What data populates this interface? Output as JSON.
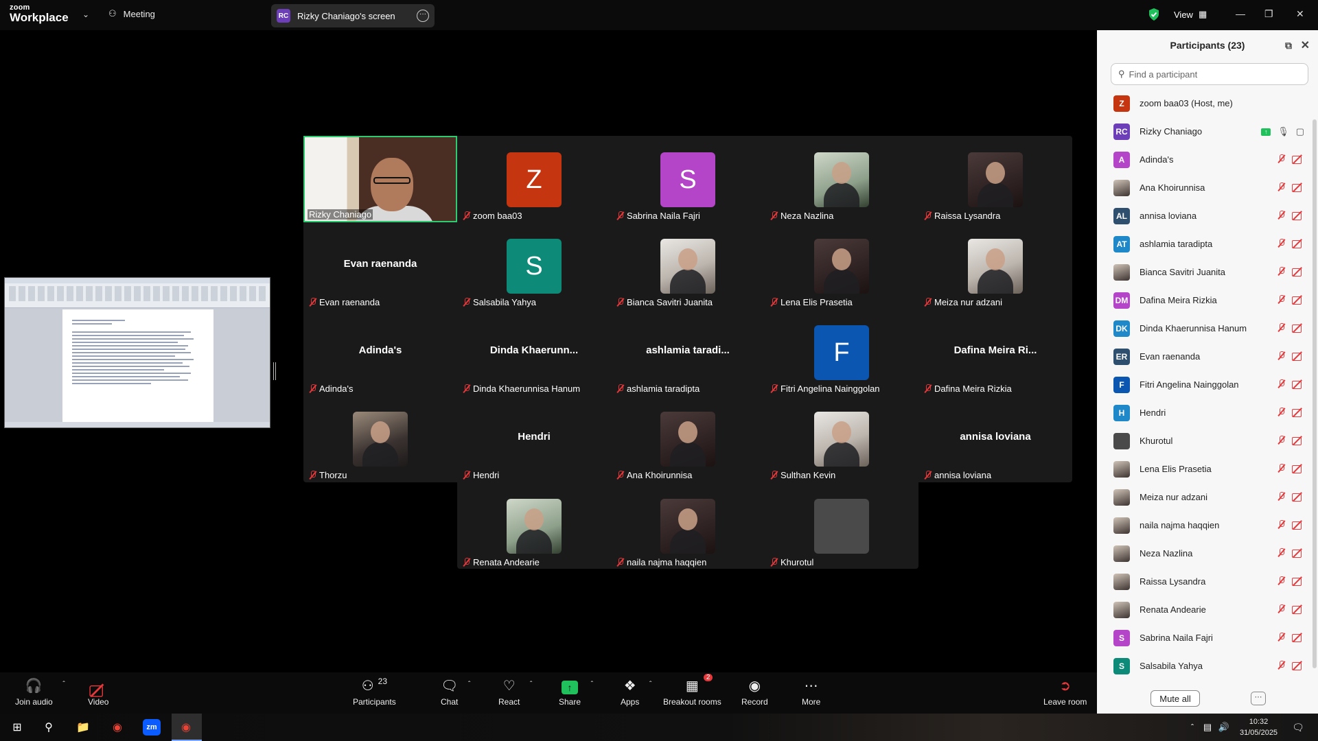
{
  "title_bar": {
    "logo_top": "zoom",
    "logo_bottom": "Workplace",
    "meeting_label": "Meeting",
    "screen_tab_badge": "RC",
    "screen_tab_label": "Rizky Chaniago's screen",
    "view_label": "View"
  },
  "gallery": {
    "tiles": [
      {
        "name": "Rizky Chaniago",
        "type": "video"
      },
      {
        "name": "zoom baa03",
        "initial": "Z",
        "color": "#c5350f"
      },
      {
        "name": "Sabrina Naila Fajri",
        "initial": "S",
        "color": "#b444c8"
      },
      {
        "name": "Neza Nazlina",
        "type": "photo"
      },
      {
        "name": "Raissa Lysandra",
        "type": "photo"
      },
      {
        "name": "Evan raenanda",
        "big": "Evan raenanda"
      },
      {
        "name": "Salsabila Yahya",
        "initial": "S",
        "color": "#0d8a78"
      },
      {
        "name": "Bianca Savitri Juanita",
        "type": "photo"
      },
      {
        "name": "Lena Elis Prasetia",
        "type": "photo"
      },
      {
        "name": "Meiza nur adzani",
        "type": "photo"
      },
      {
        "name": "Adinda's",
        "big": "Adinda's"
      },
      {
        "name": "Dinda Khaerunnisa Hanum",
        "big": "Dinda  Khaerunn..."
      },
      {
        "name": "ashlamia taradipta",
        "big": "ashlamia  taradi..."
      },
      {
        "name": "Fitri Angelina Nainggolan",
        "initial": "F",
        "color": "#0a56b0"
      },
      {
        "name": "Dafina Meira Rizkia",
        "big": "Dafina Meira Ri..."
      },
      {
        "name": "Thorzu",
        "type": "photo"
      },
      {
        "name": "Hendri",
        "big": "Hendri"
      },
      {
        "name": "Ana Khoirunnisa",
        "type": "photo"
      },
      {
        "name": "Sulthan Kevin",
        "type": "photo"
      },
      {
        "name": "annisa loviana",
        "big": "annisa loviana"
      },
      {
        "name": "Renata Andearie",
        "type": "photo"
      },
      {
        "name": "naila najma haqqien",
        "type": "photo"
      },
      {
        "name": "Khurotul",
        "initial": "",
        "color": "#4a4a4a"
      }
    ]
  },
  "participants_panel": {
    "title": "Participants (23)",
    "search_placeholder": "Find a participant",
    "mute_all_label": "Mute all",
    "more_label": "···",
    "list": [
      {
        "name": "zoom baa03 (Host, me)",
        "initial": "Z",
        "color": "#c5350f",
        "icons": false
      },
      {
        "name": "Rizky Chaniago",
        "initial": "RC",
        "color": "#6c3fb8",
        "sharing": true
      },
      {
        "name": "Adinda's",
        "initial": "A",
        "color": "#b444c8"
      },
      {
        "name": "Ana Khoirunnisa",
        "photo": true
      },
      {
        "name": "annisa loviana",
        "initial": "AL",
        "color": "#2f4f6f"
      },
      {
        "name": "ashlamia taradipta",
        "initial": "AT",
        "color": "#1e88c9"
      },
      {
        "name": "Bianca Savitri Juanita",
        "photo": true
      },
      {
        "name": "Dafina Meira Rizkia",
        "initial": "DM",
        "color": "#b444c8"
      },
      {
        "name": "Dinda Khaerunnisa Hanum",
        "initial": "DK",
        "color": "#1e88c9"
      },
      {
        "name": "Evan raenanda",
        "initial": "ER",
        "color": "#2f4f6f"
      },
      {
        "name": "Fitri Angelina Nainggolan",
        "initial": "F",
        "color": "#0a56b0"
      },
      {
        "name": "Hendri",
        "initial": "H",
        "color": "#1e88c9"
      },
      {
        "name": "Khurotul",
        "initial": "",
        "color": "#4a4a4a"
      },
      {
        "name": "Lena Elis Prasetia",
        "photo": true
      },
      {
        "name": "Meiza nur adzani",
        "photo": true
      },
      {
        "name": "naila najma haqqien",
        "photo": true
      },
      {
        "name": "Neza Nazlina",
        "photo": true
      },
      {
        "name": "Raissa Lysandra",
        "photo": true
      },
      {
        "name": "Renata Andearie",
        "photo": true
      },
      {
        "name": "Sabrina Naila Fajri",
        "initial": "S",
        "color": "#b444c8"
      },
      {
        "name": "Salsabila Yahya",
        "initial": "S",
        "color": "#0d8a78"
      }
    ]
  },
  "toolbar": {
    "join_audio": "Join audio",
    "video": "Video",
    "participants": "Participants",
    "participants_count": "23",
    "chat": "Chat",
    "react": "React",
    "share": "Share",
    "apps": "Apps",
    "breakout_rooms": "Breakout rooms",
    "breakout_badge": "2",
    "record": "Record",
    "more": "More",
    "leave_room": "Leave room"
  },
  "taskbar": {
    "time": "10:32",
    "date": "31/05/2025",
    "zoom_icon_label": "zm"
  },
  "colors": {
    "accent_green": "#2ecc71",
    "mute_red": "#e5383b",
    "share_green": "#20c05c"
  }
}
